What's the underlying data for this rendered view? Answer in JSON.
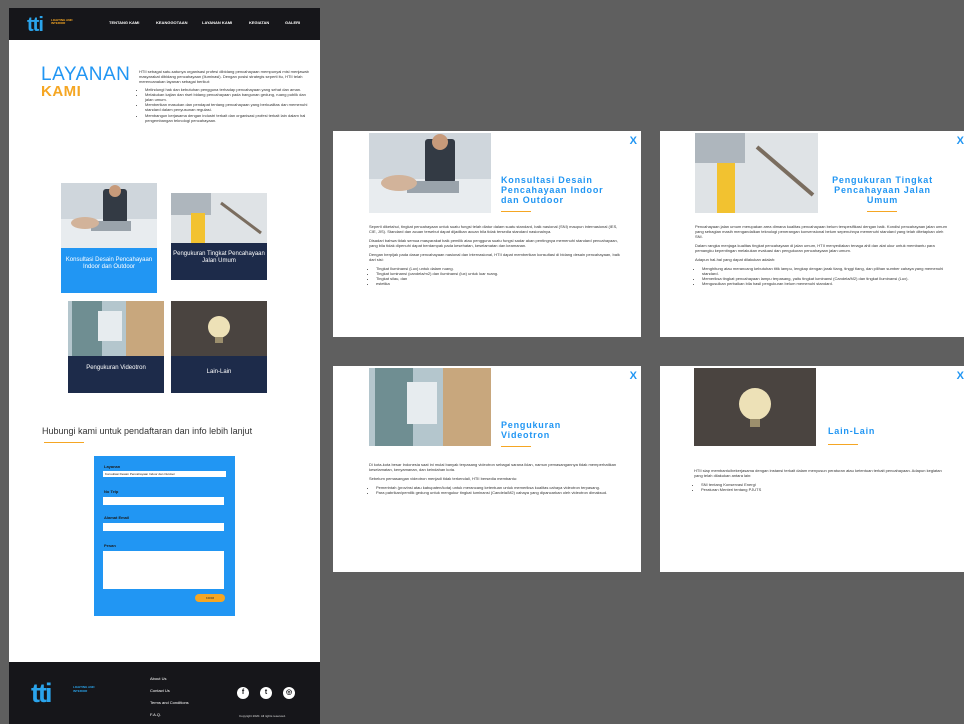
{
  "header": {
    "logo": "tti",
    "logo_sub": "LIGHTING AND INTERIOR",
    "nav": [
      "TENTANG KAMI",
      "KEANGGOTAAN",
      "LAYANAN KAMI",
      "KEGIATAN",
      "GALERI"
    ]
  },
  "layanan": {
    "title1": "LAYANAN",
    "title2": "KAMI",
    "intro": "HTII sebagai satu-satunya organisasi profesi dibidang pencahayaan mempunyai misi menjawab masyarakat dibidang pencahayaan (Iluminasi). Dengan posisi strategis seperti itu, HTII telah merencanakan layanan sebagai berikut:",
    "bullets": [
      "Melindungi hak dan kebutuhan pengguna terhadap pencahayaan yang sehat dan aman.",
      "Melakukan kajian dan riset bidang pencahayaan pada bangunan gedung, ruang publik dan jalan umum.",
      "Memberikan masukan dan pendapat tentang pencahayaan yang berkualitas dan memenuhi standard dalam penyusunan regulasi.",
      "Membangun kerjasama dengan industri terkait dan organisasi profesi terkait lain dalam hal pengembangan teknologi pencahayaan."
    ]
  },
  "cards": [
    {
      "label": "Konsultasi Desain Pencahayaan Indoor dan Outdoor"
    },
    {
      "label": "Pengukuran Tingkat Pencahayaan Jalan Umum"
    },
    {
      "label": "Pengukuran Videotron"
    },
    {
      "label": "Lain-Lain"
    }
  ],
  "contact": {
    "heading": "Hubungi kami untuk pendaftaran dan info lebih lanjut",
    "layanan_label": "Layanan",
    "layanan_value": "Konsultasi Desain Pencahayaan Indoor dan Outdoor",
    "telp_label": "No Telp",
    "email_label": "Alamat Email",
    "pesan_label": "Pesan",
    "submit": "KIRIM"
  },
  "footer": {
    "logo": "tti",
    "logo_sub": "LIGHTING AND INTERIOR",
    "links": [
      "About Us",
      "Contact Us",
      "Terms and Conditions",
      "F.A.Q."
    ],
    "copyright": "Copyright 2020. All rights reserved."
  },
  "panels": [
    {
      "title": "Konsultasi Desain Pencahayaan Indoor dan Outdoor",
      "close": "X",
      "paragraphs": [
        "Seperti diketahui, tingkat pencahayaan untuk suatu fungsi telah diatur dalam suatu standard, baik nasional (SNI) maupun internasional (IES, CIE, JIS). Standard dan acuan tersebut dapat dijadikan acuan bila tidak tersedia standard nasionalnya.",
        "Disadari bahwa tidak semua masyarakat baik pemilik atau pengguna suatu fungsi sadar akan pentingnya memenuhi standard pencahayaan, yang bila tidak dipenuhi dapat berdampak pada kesehatan, keselamatan dan keamanan.",
        "Dengan berpijak pada dasar pencahayaan nasional dan internasional, HTII dapat memberikan konsultasi di bidang desain pencahayaan, baik dari sisi:"
      ],
      "bullets": [
        "Tingkat Iluminansi (Lux) untuk dalam ruang.",
        "Tingkat luminansi (candela/m2) dan iluminansi (lux) untuk luar ruang.",
        "Tingkat silau, dan",
        "estetika"
      ]
    },
    {
      "title": "Pengukuran Tingkat Pencahayaan Jalan Umum",
      "close": "X",
      "paragraphs": [
        "Pencahayaan jalan umum merupakan area dimana kualitas pencahayaan belum terspesifikasi dengan baik. Kondisi pencahayaan jalan umum yang sebagian masih mengandalkan teknologi penerangan konvensional belum sepenuhnya memenuhi standard yang telah ditetapkan oleh SNI.",
        "Dalam rangka menjaga kualitas tingkat pencahayaan di jalan umum, HTII menyediakan tenaga ahli dan alat ukur untuk membantu para pemangku kepentingan melakukan evaluasi dan pengukuran pencahayaan jalan umum.",
        "Adapun hal-hal yang dapat dilakukan adalah:"
      ],
      "bullets": [
        "Menghitung atau merancang kebutuhan titik lampu, lengkap dengan jarak tiang, tinggi tiang, dan pilihan sumber cahaya yang memenuhi standard.",
        "Memeriksa tingkat pencahayaan lampu terpasang, yaitu tingkat luminansi (Candela/M2) dan tingkat Iluminansi (Lux).",
        "Mengusulkan perbaikan bila hasil pengukuran belum memenuhi standard."
      ]
    },
    {
      "title": "Pengukuran Videotron",
      "close": "X",
      "paragraphs": [
        "Di kota-kota besar Indonesia saat ini mulai banyak terpasang videotron sebagai sarana iklan, namun pemasangannya tidak memperhatikan keselamatan, kenyamanan, dan keindahan kota.",
        "Sebelum pemasangan videotron menjadi tidak terkendali, HTII bersedia membantu:"
      ],
      "bullets": [
        "Pemerintah (provinsi atau kabupaten/kota) untuk merancang ketentuan untuk memeriksa kualitas cahaya videotron terpasang.",
        "Para pabrikan/pemilik gedung untuk mengukur tingkat luminansi (Candela/M2) cahaya yang dipancarkan oleh videotron dimaksud."
      ]
    },
    {
      "title": "Lain-Lain",
      "close": "X",
      "paragraphs": [
        "HTII siap membantu/bekerjasama dengan instansi terkait dalam menyusun peraturan atau ketentuan terkait pencahayaan. Adapun kegiatan yang telah dilakukan antara lain:"
      ],
      "bullets": [
        "SNI tentang Konservasi Energi",
        "Peraturan Menteri tentang PJUTS"
      ]
    }
  ],
  "colors": {
    "accent": "#2196f3",
    "orange": "#f5a623",
    "dark": "#16161a",
    "navy": "#1d2b4a"
  }
}
